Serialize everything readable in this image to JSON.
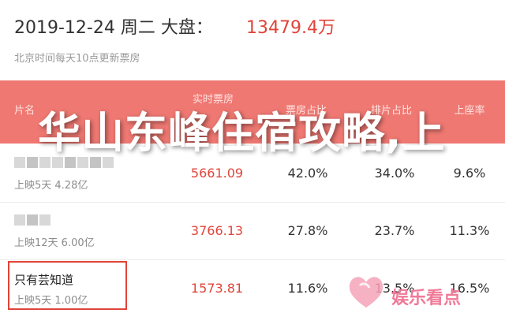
{
  "header": {
    "date": "2019-12-24 周二 大盘：",
    "total": "13479.4万",
    "subtitle": "北京时间每天10点更新票房"
  },
  "table_header": {
    "film": "片名",
    "realtime_boxoffice": "实时票房",
    "boxoffice_share": "票房占比",
    "screening_share": "排片占比",
    "attendance": "上座率"
  },
  "rows": [
    {
      "name": "",
      "meta": "上映5天 4.28亿",
      "boxoffice": "5661.09",
      "share": "42.0%",
      "screening": "34.0%",
      "attendance": "9.6%"
    },
    {
      "name": "",
      "meta": "上映12天 6.00亿",
      "boxoffice": "3766.13",
      "share": "27.8%",
      "screening": "23.7%",
      "attendance": "11.3%"
    },
    {
      "name": "只有芸知道",
      "meta": "上映5天 1.00亿",
      "boxoffice": "1573.81",
      "share": "11.6%",
      "screening": "13.5%",
      "attendance": "16.5%"
    }
  ],
  "overlay_title": "华山东峰住宿攻略,上",
  "watermark": "娱乐看点",
  "colors": {
    "accent": "#e0443a",
    "header_band": "#ef7872",
    "watermark": "#f07a98"
  }
}
